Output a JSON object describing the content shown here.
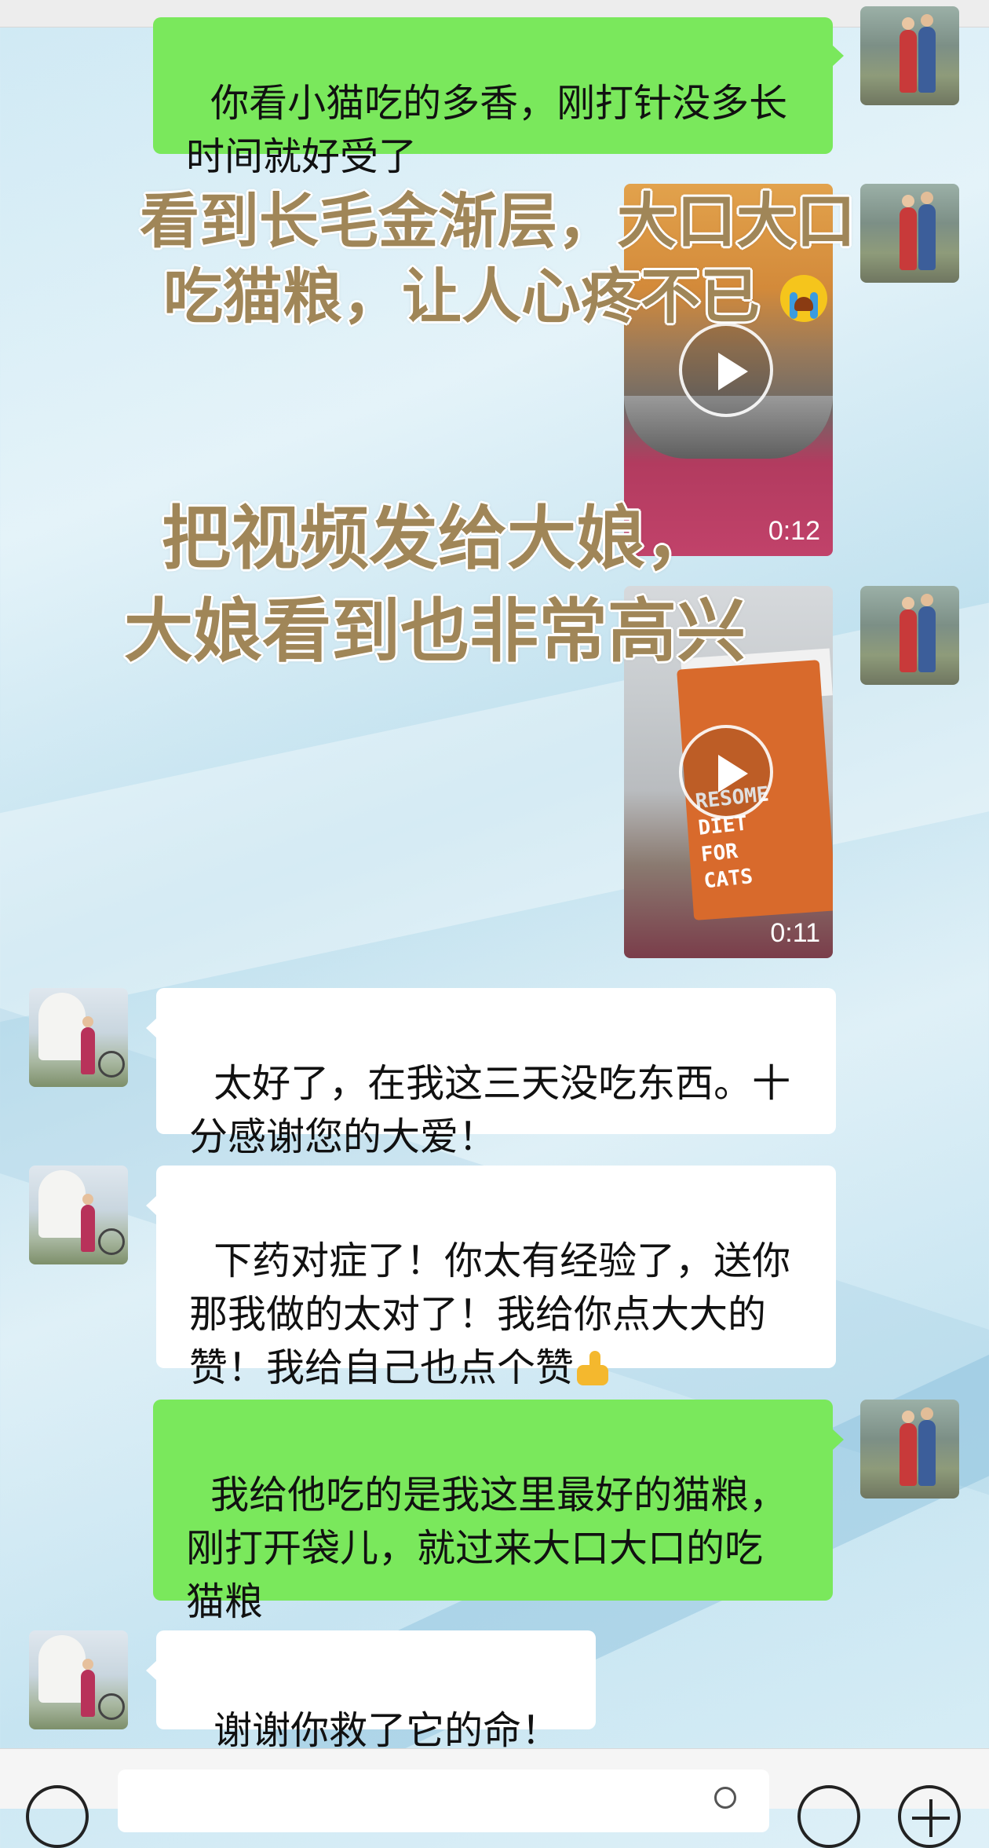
{
  "messages": [
    {
      "sender": "self",
      "type": "text",
      "text": "你看小猫吃的多香，刚打针没多长\n时间就好受了"
    },
    {
      "sender": "self",
      "type": "video",
      "duration": "0:12"
    },
    {
      "sender": "self",
      "type": "video",
      "duration": "0:11",
      "product_text": "RESOME\nDIET\nFOR\nCATS"
    },
    {
      "sender": "other",
      "type": "text",
      "text": "太好了，在我这三天没吃东西。十\n分感谢您的大爱！"
    },
    {
      "sender": "other",
      "type": "text",
      "text": "下药对症了！你太有经验了，送你\n那我做的太对了！我给你点大大的\n赞！我给自己也点个赞"
    },
    {
      "sender": "self",
      "type": "text",
      "text": "我给他吃的是我这里最好的猫粮，\n刚打开袋儿，就过来大口大口的吃\n猫粮"
    },
    {
      "sender": "other",
      "type": "text",
      "text": "谢谢你救了它的命！"
    }
  ],
  "overlay_captions": {
    "caption1_line1": "看到长毛金渐层，大口大口",
    "caption1_line2": "吃猫粮，让人心疼不已",
    "caption2_line1": "把视频发给大娘，",
    "caption2_line2": "大娘看到也非常高兴"
  },
  "colors": {
    "self_bubble": "#7ae85c",
    "other_bubble": "#ffffff",
    "caption_text": "#a08658"
  },
  "icons": [
    "voice-icon",
    "mic-icon",
    "emoji-icon",
    "plus-icon",
    "play-icon",
    "crying-emoji-icon",
    "thumbs-up-emoji-icon"
  ]
}
